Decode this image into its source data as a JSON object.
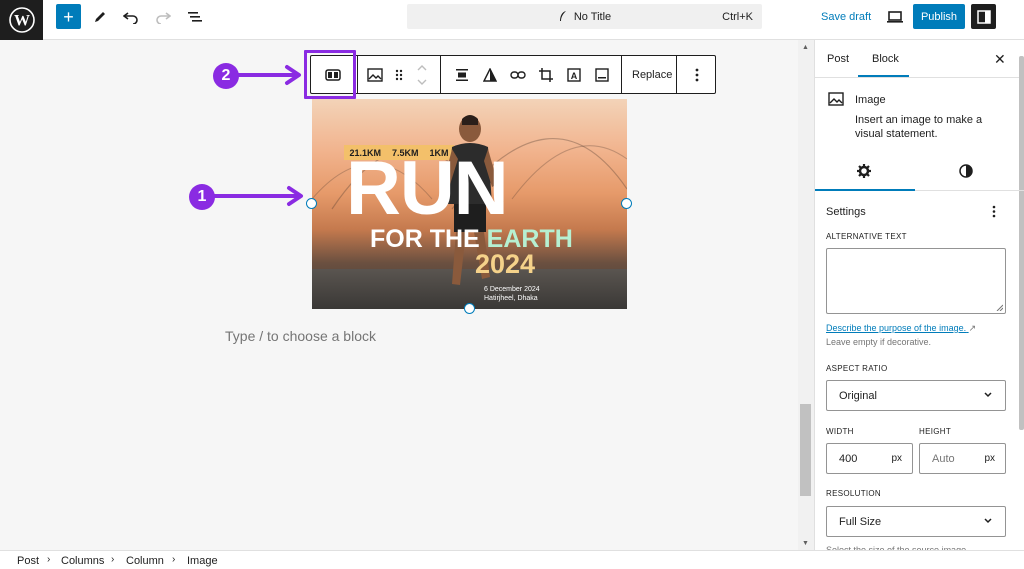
{
  "topbar": {
    "document_title": "No Title",
    "shortcut": "Ctrl+K",
    "save_draft": "Save draft",
    "publish": "Publish"
  },
  "block_toolbar": {
    "replace": "Replace"
  },
  "annotations": {
    "badge_1": "1",
    "badge_2": "2",
    "accent_color": "#8a2be2"
  },
  "image": {
    "distances": [
      "21.1KM",
      "7.5KM",
      "1KM"
    ],
    "headline": "RUN",
    "subline_part1": "FOR THE ",
    "subline_part2": "EARTH",
    "year": "2024",
    "date": "6 December 2024",
    "location": "Hatirjheel, Dhaka"
  },
  "canvas": {
    "placeholder": "Type / to choose a block"
  },
  "sidebar": {
    "tabs": [
      "Post",
      "Block"
    ],
    "block_name": "Image",
    "block_description": "Insert an image to make a visual statement.",
    "section_title": "Settings",
    "alt_text_label": "ALTERNATIVE TEXT",
    "alt_help_link": "Describe the purpose of the image.",
    "alt_help_text": "Leave empty if decorative.",
    "aspect_ratio_label": "ASPECT RATIO",
    "aspect_ratio_value": "Original",
    "width_label": "WIDTH",
    "width_value": "400",
    "width_unit": "px",
    "height_label": "HEIGHT",
    "height_placeholder": "Auto",
    "height_unit": "px",
    "resolution_label": "RESOLUTION",
    "resolution_value": "Full Size",
    "resolution_help": "Select the size of the source image."
  },
  "breadcrumb": [
    "Post",
    "Columns",
    "Column",
    "Image"
  ],
  "colors": {
    "primary": "#007cba",
    "dark": "#1e1e1e"
  }
}
